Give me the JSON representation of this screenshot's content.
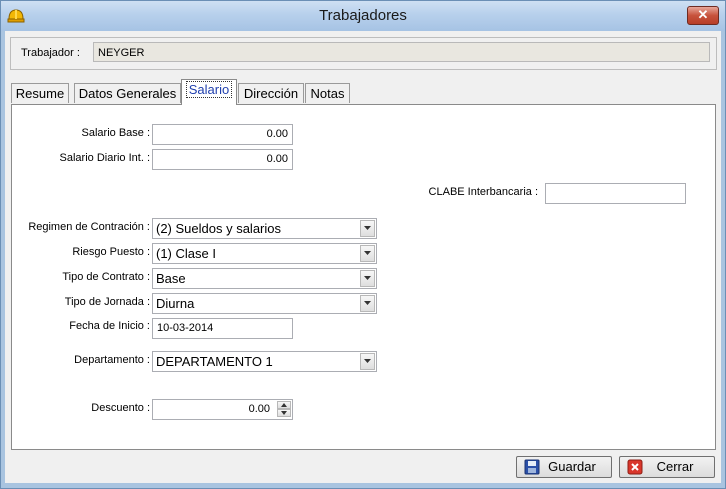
{
  "window": {
    "title": "Trabajadores",
    "close_label": "✕"
  },
  "header": {
    "trabajador_label": "Trabajador :",
    "trabajador_value": "NEYGER"
  },
  "tabs": [
    {
      "label": "Resume",
      "hotkey": "R",
      "active": false
    },
    {
      "label": "Datos Generales",
      "hotkey": "",
      "active": false
    },
    {
      "label": "Salario",
      "hotkey": "S",
      "active": true
    },
    {
      "label": "Dirección",
      "hotkey": "D",
      "active": false
    },
    {
      "label": "Notas",
      "hotkey": "N",
      "active": false
    }
  ],
  "form": {
    "salario_base_label": "Salario Base :",
    "salario_base_value": "0.00",
    "salario_diario_label": "Salario Diario Int. :",
    "salario_diario_value": "0.00",
    "clabe_label": "CLABE Interbancaria :",
    "clabe_value": "",
    "regimen_label": "Regimen de Contración :",
    "regimen_value": "(2) Sueldos y salarios",
    "riesgo_label": "Riesgo Puesto :",
    "riesgo_value": "(1) Clase I",
    "tipo_contrato_label": "Tipo de Contrato :",
    "tipo_contrato_value": "Base",
    "tipo_jornada_label": "Tipo de Jornada :",
    "tipo_jornada_value": "Diurna",
    "fecha_inicio_label": "Fecha de Inicio :",
    "fecha_inicio_value": "10-03-2014",
    "departamento_label": "Departamento :",
    "departamento_value": "DEPARTAMENTO 1",
    "descuento_label": "Descuento :",
    "descuento_value": "0.00"
  },
  "buttons": {
    "guardar": "Guardar",
    "cerrar": "Cerrar"
  },
  "colors": {
    "title_bar": "#b7d0ec",
    "close_button": "#c7523c",
    "active_tab_text": "#1f3fae"
  }
}
